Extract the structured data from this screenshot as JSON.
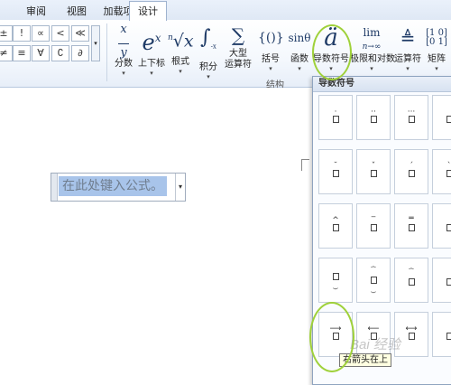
{
  "tabs": [
    "审阅",
    "视图",
    "加载项",
    "设计"
  ],
  "symbols": [
    "±",
    "!",
    "∝",
    "<",
    "≪",
    "≠",
    "∀",
    "∁",
    "∂",
    "±",
    "≡",
    "∓"
  ],
  "tools": [
    {
      "icon": "x/y",
      "label": "分数"
    },
    {
      "icon": "eˣ",
      "label": "上下标"
    },
    {
      "icon": "ⁿ√x",
      "label": "根式"
    },
    {
      "icon": "∫",
      "label": "积分"
    },
    {
      "icon": "∑",
      "label": "大型",
      "label2": "运算符"
    },
    {
      "icon": "{()}",
      "label": "括号"
    },
    {
      "icon": "sinθ",
      "label": "函数"
    },
    {
      "icon": "ä",
      "label": "导数符号"
    },
    {
      "icon": "lim",
      "icon2": "n→∞",
      "label": "极限和对数"
    },
    {
      "icon": "△",
      "label": "运算符"
    },
    {
      "icon": "[10/01]",
      "label": "矩阵"
    }
  ],
  "group_label": "结构",
  "equation_placeholder": "在此处键入公式。",
  "panel": {
    "title": "导数符号",
    "cells": [
      [
        "□̇",
        "□̈",
        "□⃛",
        "□"
      ],
      [
        "□̆",
        "□̌",
        "□́",
        "□̀"
      ],
      [
        "□̂",
        "□̄",
        "□̄",
        "□"
      ],
      [
        "□",
        "□",
        "□",
        "□"
      ],
      [
        "□",
        "□",
        "□",
        "□"
      ]
    ]
  },
  "tooltip": "右箭头在上",
  "watermark": "Bai 经验"
}
